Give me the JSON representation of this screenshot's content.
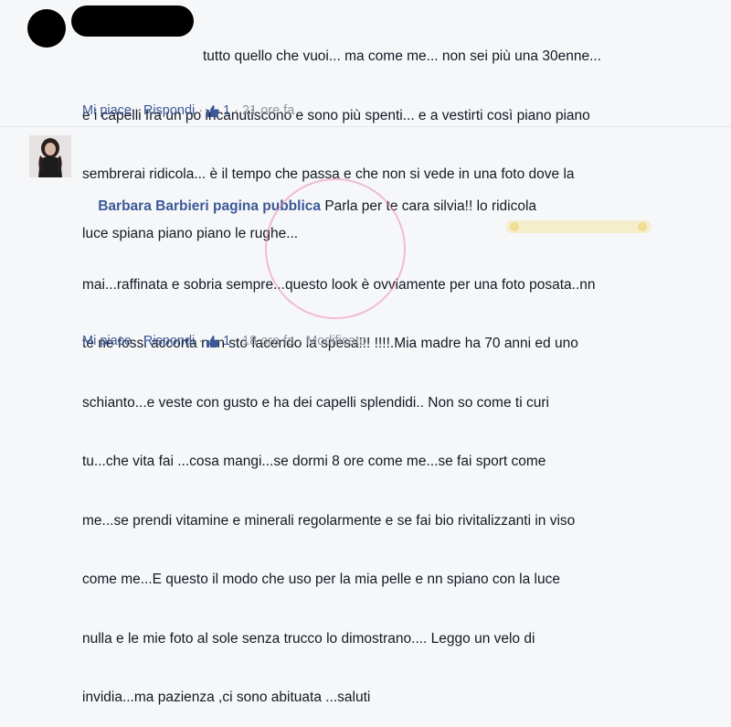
{
  "comments": [
    {
      "author": "",
      "lines": [
        "tutto quello che vuoi... ma come me... non sei più una 30enne...",
        "e i capelli fra un po incanutiscono e sono più spenti... e a vestirti così piano piano",
        "sembrerai ridicola... è il tempo che passa e che non si vede in una foto dove la",
        "luce spiana piano piano le rughe..."
      ],
      "actions": {
        "like": "Mi piace",
        "reply": "Rispondi",
        "like_count": "1",
        "time": "21 ore fa",
        "edited": ""
      }
    },
    {
      "author": "Barbara Barbieri pagina pubblica",
      "first_line_rest": "Parla per te cara silvia!! lo ridicola",
      "lines": [
        "mai...raffinata e sobria sempre...questo look è ovviamente per una foto posata..nn",
        "te ne fossi accorta non sto facendo la spesa!!! !!!!.Mia madre ha 70 anni ed uno",
        "schianto...e veste con gusto e ha dei capelli splendidi.. Non so come ti curi",
        "tu...che vita fai ...cosa mangi...se dormi 8 ore come me...se fai sport come",
        "me...se prendi vitamine e minerali regolarmente e se fai bio rivitalizzanti in viso",
        "come me...E questo il modo che uso per la mia pelle e nn spiano con la luce",
        "nulla e le mie foto al sole senza trucco lo dimostrano.... Leggo un velo di",
        "invidia...ma pazienza ,ci sono abituata ...saluti"
      ],
      "actions": {
        "like": "Mi piace",
        "reply": "Rispondi",
        "like_count": "1",
        "time": "18 ore fa",
        "edited": "Modificato"
      }
    }
  ],
  "colors": {
    "link": "#3b5998",
    "meta": "#90949c",
    "text": "#141823",
    "background": "#f6f7f9"
  },
  "icons": {
    "like": "thumbs-up-icon"
  }
}
